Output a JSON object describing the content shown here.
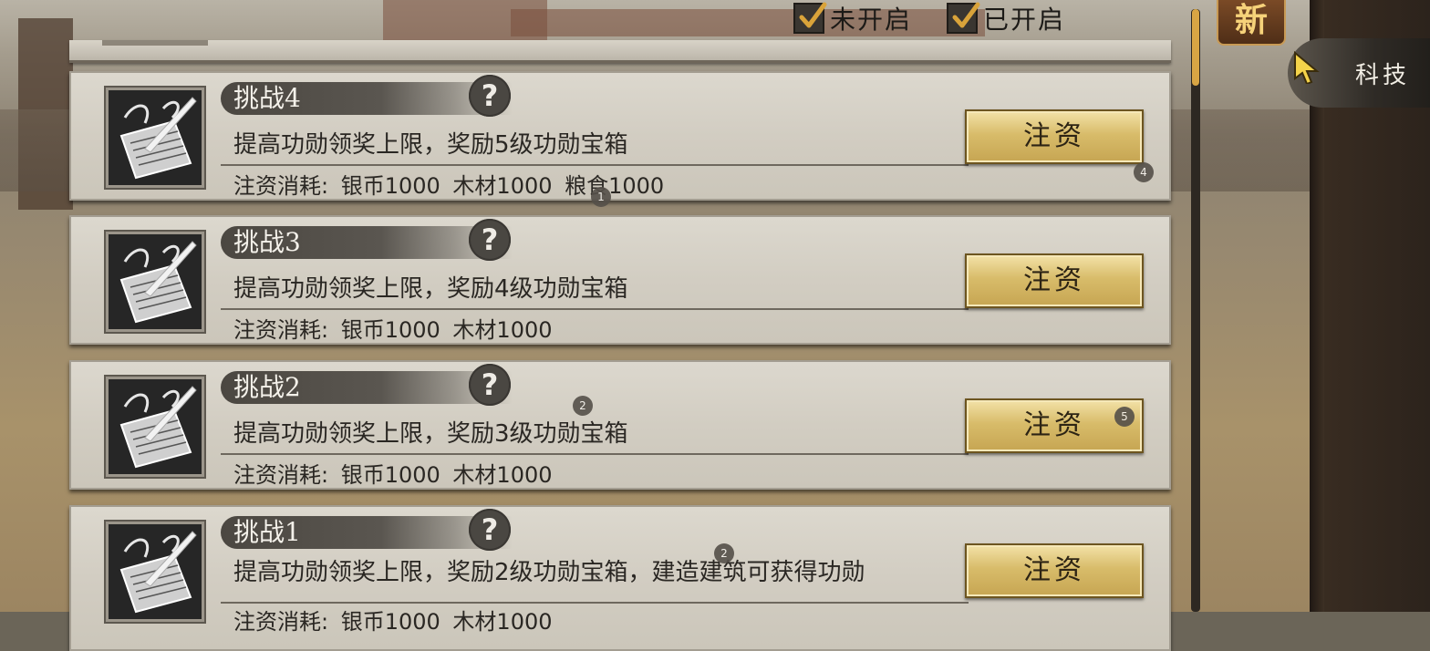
{
  "filters": [
    {
      "label": "未开启",
      "checked": true
    },
    {
      "label": "已开启",
      "checked": true
    }
  ],
  "new_badge": "新",
  "side_tab": {
    "label": "科技"
  },
  "help_symbol": "?",
  "cards": [
    {
      "title": "挑战4",
      "description": "提高功勋领奖上限，奖励5级功勋宝箱",
      "cost": "注资消耗: 银币1000  木材1000  粮食1000",
      "button": "注资"
    },
    {
      "title": "挑战3",
      "description": "提高功勋领奖上限，奖励4级功勋宝箱",
      "cost": "注资消耗: 银币1000  木材1000",
      "button": "注资"
    },
    {
      "title": "挑战2",
      "description": "提高功勋领奖上限，奖励3级功勋宝箱",
      "cost": "注资消耗: 银币1000  木材1000",
      "button": "注资"
    },
    {
      "title": "挑战1",
      "description": "提高功勋领奖上限，奖励2级功勋宝箱，建造建筑可获得功勋",
      "cost": "注资消耗: 银币1000  木材1000",
      "button": "注资"
    }
  ],
  "markers": [
    "1",
    "2",
    "2",
    "4",
    "5"
  ],
  "icons": {
    "card_icon": "document-brush-icon",
    "help": "question-icon",
    "check": "checkmark-icon",
    "cursor": "pointer-cursor-icon"
  }
}
